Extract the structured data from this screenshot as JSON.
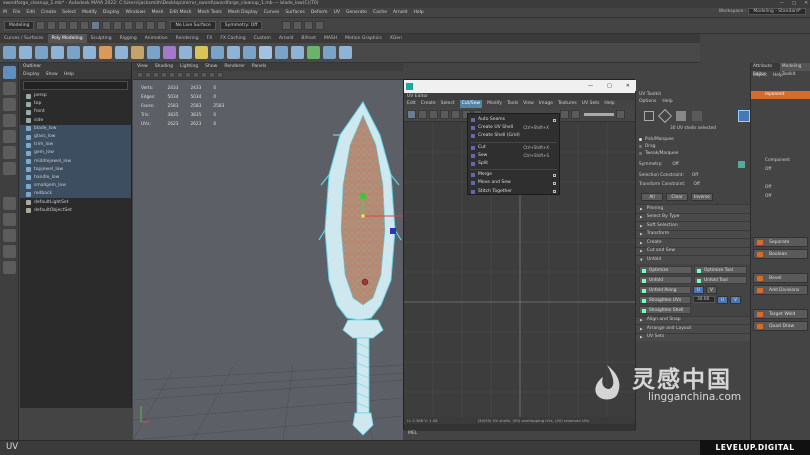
{
  "window": {
    "title": "swordforge_cleanup_1.mb* - Autodesk MAYA 2022: C:\\Users\\jacksmith\\Desktop\\mirror_sword\\swordforge_cleanup_1.mb --- blade_low(C)(T0)"
  },
  "main_menu": [
    "File",
    "Edit",
    "Create",
    "Select",
    "Modify",
    "Display",
    "Windows",
    "Mesh",
    "Edit Mesh",
    "Mesh Tools",
    "Mesh Display",
    "Curves",
    "Surfaces",
    "Deform",
    "UV",
    "Generate",
    "Cache",
    "Arnold",
    "Help"
  ],
  "workspace": {
    "label": "Workspace :",
    "value": "Modeling - Standard*"
  },
  "status_line": {
    "mode": "Modeling",
    "live_surface": "No Live Surface",
    "symmetry": "Symmetry: Off"
  },
  "shelf_tabs": [
    "Curves / Surfaces",
    "Poly Modeling",
    "Sculpting",
    "Rigging",
    "Animation",
    "Rendering",
    "FX",
    "FX Caching",
    "Custom",
    "Arnold",
    "Bifrost",
    "MASH",
    "Motion Graphics",
    "XGen"
  ],
  "shelf_active": "Poly Modeling",
  "outliner": {
    "title": "Outliner",
    "menu": [
      "Display",
      "Show",
      "Help"
    ],
    "search_placeholder": "Search...",
    "items": [
      {
        "label": "persp",
        "type": "camera",
        "selected": false
      },
      {
        "label": "top",
        "type": "camera",
        "selected": false
      },
      {
        "label": "front",
        "type": "camera",
        "selected": false
      },
      {
        "label": "side",
        "type": "camera",
        "selected": false
      },
      {
        "label": "blade_low",
        "type": "mesh",
        "selected": true
      },
      {
        "label": "glass_low",
        "type": "mesh",
        "selected": true
      },
      {
        "label": "trim_low",
        "type": "mesh",
        "selected": true
      },
      {
        "label": "gem_low",
        "type": "mesh",
        "selected": true
      },
      {
        "label": "middlejewel_low",
        "type": "mesh",
        "selected": true
      },
      {
        "label": "topjewel_low",
        "type": "mesh",
        "selected": true
      },
      {
        "label": "handle_low",
        "type": "mesh",
        "selected": true
      },
      {
        "label": "smallgem_low",
        "type": "mesh",
        "selected": true
      },
      {
        "label": "redback",
        "type": "mesh",
        "selected": true
      },
      {
        "label": "defaultLightSet",
        "type": "set",
        "selected": false
      },
      {
        "label": "defaultObjectSet",
        "type": "set",
        "selected": false
      }
    ]
  },
  "viewport": {
    "menu": [
      "View",
      "Shading",
      "Lighting",
      "Show",
      "Renderer",
      "Panels"
    ],
    "hud": [
      [
        "Verts:",
        "2433",
        "2433",
        "0"
      ],
      [
        "Edges:",
        "5034",
        "5034",
        "0"
      ],
      [
        "Faces:",
        "2583",
        "2583",
        "2583"
      ],
      [
        "Tris:",
        "3835",
        "3835",
        "0"
      ],
      [
        "UVs:",
        "2623",
        "2623",
        "0"
      ]
    ]
  },
  "uv_editor": {
    "title": "UV Editor",
    "window_controls": [
      "—",
      "□",
      "✕"
    ],
    "menu": [
      "Edit",
      "Create",
      "Select",
      "Cut/Sew",
      "Modify",
      "Tools",
      "View",
      "Image",
      "Textures",
      "UV Sets",
      "Help"
    ],
    "open_menu": "Cut/Sew",
    "status": "U: 0.368  V: 1.08",
    "status_right": "(30/30) UV shells, (00) overlapping UVs, (00) reversed UVs",
    "cutsew_menu": [
      {
        "label": "Auto Seams",
        "shortcut": "",
        "option": true
      },
      {
        "label": "Create UV Shell",
        "shortcut": "Ctrl+Shift+X",
        "option": false
      },
      {
        "label": "Create Shell (Grid)",
        "shortcut": "",
        "option": false
      },
      {
        "label": "Cut",
        "shortcut": "Ctrl+Shift+X",
        "option": false
      },
      {
        "label": "Sew",
        "shortcut": "Ctrl+Shift+S",
        "option": false
      },
      {
        "label": "Split",
        "shortcut": "",
        "option": false
      },
      {
        "label": "Merge",
        "shortcut": "",
        "option": true
      },
      {
        "label": "Move and Sew",
        "shortcut": "",
        "option": true
      },
      {
        "label": "Stitch Together",
        "shortcut": "",
        "option": true
      }
    ]
  },
  "uv_toolkit": {
    "title": "UV Toolkit",
    "menu": [
      "Options",
      "Help"
    ],
    "selection_info": "30 UV shells selected",
    "modes": [
      "Pick/Marquee",
      "Drag",
      "Tweak/Marquee"
    ],
    "symmetry": {
      "label": "Symmetry:",
      "value": "Off"
    },
    "selection_constraint": {
      "label": "Selection Constraint:",
      "value": "Off"
    },
    "transform_constraint": {
      "label": "Transform Constraint:",
      "value": "Off"
    },
    "sel_buttons": [
      "All",
      "Clear",
      "Inverse"
    ],
    "sections_top": [
      "Pinning",
      "Select By Type",
      "Soft Selection",
      "Transform",
      "Create",
      "Cut and Sew"
    ],
    "unfold_section": "Unfold",
    "unfold_buttons": [
      [
        "Optimize",
        "Optimize Tool"
      ],
      [
        "Unfold",
        "Unfold Tool"
      ]
    ],
    "unfold_along": {
      "label": "Unfold Along",
      "u": "U",
      "v": "V"
    },
    "straighten_uvs": {
      "label": "Straighten UVs",
      "value": "30.00",
      "u": "U",
      "v": "V"
    },
    "straighten_shell": "Straighten Shell",
    "sections_bottom": [
      "Align and Snap",
      "Arrange and Layout",
      "UV Sets"
    ]
  },
  "right_panel": {
    "tabs": [
      "Attribute Editor",
      "Modeling Toolkit"
    ],
    "menu": [
      "Object",
      "Help"
    ],
    "truncated": [
      "mponent",
      "Component",
      "Off",
      "Off",
      "Off"
    ],
    "buttons": [
      "Separate",
      "Boolean",
      "Bevel",
      "Add Divisions",
      "Target Weld",
      "Quad Draw"
    ]
  },
  "watermark": {
    "chinese": "灵感中国",
    "url": "lingganchina.com"
  },
  "help_line": {
    "text": "UV",
    "mel": "MEL"
  },
  "badge": "LEVELUP.DIGITAL",
  "colors": {
    "accent_blue": "#5285a6",
    "wireframe": "#5fd6e6",
    "blade_fill": "#b8876e",
    "maya_teal": "#19a89a"
  }
}
